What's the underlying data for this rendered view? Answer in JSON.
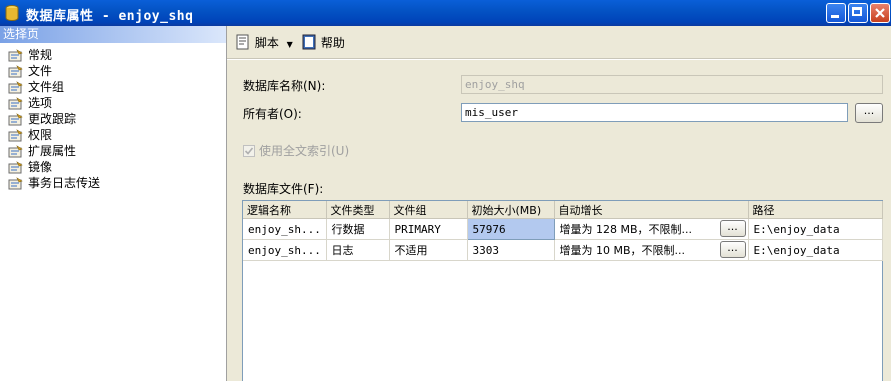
{
  "window": {
    "title": "数据库属性 - enjoy_shq"
  },
  "sidebar": {
    "header": "选择页",
    "items": [
      {
        "label": "常规"
      },
      {
        "label": "文件"
      },
      {
        "label": "文件组"
      },
      {
        "label": "选项"
      },
      {
        "label": "更改跟踪"
      },
      {
        "label": "权限"
      },
      {
        "label": "扩展属性"
      },
      {
        "label": "镜像"
      },
      {
        "label": "事务日志传送"
      }
    ]
  },
  "toolbar": {
    "script_label": "脚本",
    "help_label": "帮助"
  },
  "form": {
    "db_name_label": "数据库名称(N):",
    "db_name_value": "enjoy_shq",
    "owner_label": "所有者(O):",
    "owner_value": "mis_user",
    "browse_label": "...",
    "fulltext_label": "使用全文索引(U)",
    "files_label": "数据库文件(F):"
  },
  "files_table": {
    "columns": [
      "逻辑名称",
      "文件类型",
      "文件组",
      "初始大小(MB)",
      "自动增长",
      "路径"
    ],
    "rows": [
      {
        "logical": "enjoy_sh...",
        "type": "行数据",
        "group": "PRIMARY",
        "size": "57976",
        "growth": "增量为 128 MB，不限制...",
        "path": "E:\\enjoy_data"
      },
      {
        "logical": "enjoy_sh...",
        "type": "日志",
        "group": "不适用",
        "size": "3303",
        "growth": "增量为 10 MB，不限制...",
        "path": "E:\\enjoy_data"
      }
    ],
    "dots_label": "..."
  }
}
